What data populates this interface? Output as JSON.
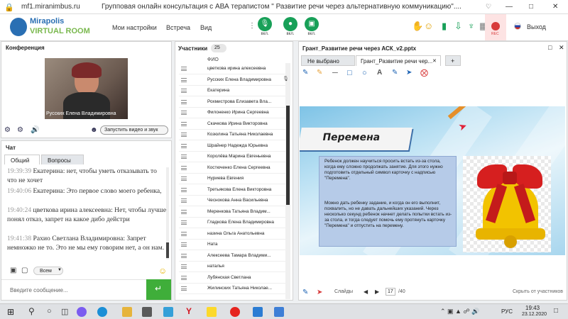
{
  "browser": {
    "url": "mf1.miranimbus.ru",
    "title": "Групповая онлайн консультация с АВА терапистом \" Развитие речи через альтернативную коммуникацию\"...."
  },
  "header": {
    "logo_top": "Mirapolis",
    "logo_bottom": "VIRTUAL ROOM",
    "menu": [
      "Мои настройки",
      "Встреча",
      "Вид"
    ],
    "controls": [
      {
        "icon": "microphone-icon",
        "label": "вкл."
      },
      {
        "icon": "camera-icon",
        "label": "вкл."
      },
      {
        "icon": "screen-icon",
        "label": "вкл."
      }
    ],
    "rec_label": "REC",
    "exit_label": "Выход",
    "colors": {
      "accent": "#18a058",
      "rec": "#d83b3b"
    }
  },
  "conference": {
    "title": "Конференция",
    "speaker": "Русских Елена Владимировна",
    "start_button": "Запустить видео и звук"
  },
  "chat": {
    "title": "Чат",
    "tabs": [
      "Общий",
      "Вопросы"
    ],
    "messages": [
      {
        "time": "19:39:39",
        "text": "Екатерина: нет, чтобы уметь отказывать то что не хочет"
      },
      {
        "time": "19:40:06",
        "text": "Екатерина: Это первое слово моего ребенка,"
      },
      {
        "time": "19:40:24",
        "text": "цветкова  ирина алексеевна: Нет, чтобы лучше понял отказ, запрет на какое дибо дейстри"
      },
      {
        "time": "19:41:38",
        "text": "Рахио Светлана  Владимировна: Запрет немножко не то. Это не мы ему говорим нет, а он нам."
      }
    ],
    "recipient": "Всем",
    "input_placeholder": "Введите сообщение..."
  },
  "participants": {
    "title": "Участники",
    "count": "25",
    "column": "ФИО",
    "list": [
      "цветкова  ирина алексеевна",
      "Русских Елена Владимировна",
      "Екатерина",
      "Рохмистрова  Елизавета Вла...",
      "Филоненко Ирина  Сергеевна",
      "Скачкова  Ирина Викторовна",
      "Козюлина  Татьяна Николаевна",
      "Шрайнер Надежда  Юрьевна",
      "Королёва Марина Евгеньевна",
      "Костюченко  Елена Сергеевна",
      "Нуриева Евгения",
      "Третьякова  Елена Викторовна",
      "Чеснокова  Анна  Васильевна",
      "Меренкова  Татьяна  Владим...",
      "Гладкова Елена Владимировна",
      "назина  Ольга  Анатольевна",
      "Ната",
      "Алексеева  Тамара  Владими...",
      "наталья",
      "Лубянская Светлана",
      "Жилинских  Татьяна Николае..."
    ]
  },
  "presentation": {
    "window_title": "Грант_Развитие речи через АСК_v2.pptx",
    "tabs": [
      "Не выбрано",
      "Грант_Развитие речи чер..."
    ],
    "slide_title": "Перемена",
    "slide_text1": "Ребенок должен научиться просить встать из-за стола, когда ему сложно продолжать занятие. Для этого нужно подготовить отдельный символ карточку с надписью \"Перемена\".",
    "slide_text2": "Можно дать ребенку задание, и когда он его выполнит, похвалить, но не давать дальнейших указаний. Через несколько секунд ребенок начнет делать попытки встать из-за стола, и тогда следует помочь ему протянуть карточку \"Перемена\" и отпустить на перемену.",
    "slides_label": "Слайды",
    "current_slide": "17",
    "total_slides": "/40",
    "hide_label": "Скрыть от участников"
  },
  "taskbar": {
    "lang": "РУС",
    "time": "19:43",
    "date": "23.12.2020"
  }
}
